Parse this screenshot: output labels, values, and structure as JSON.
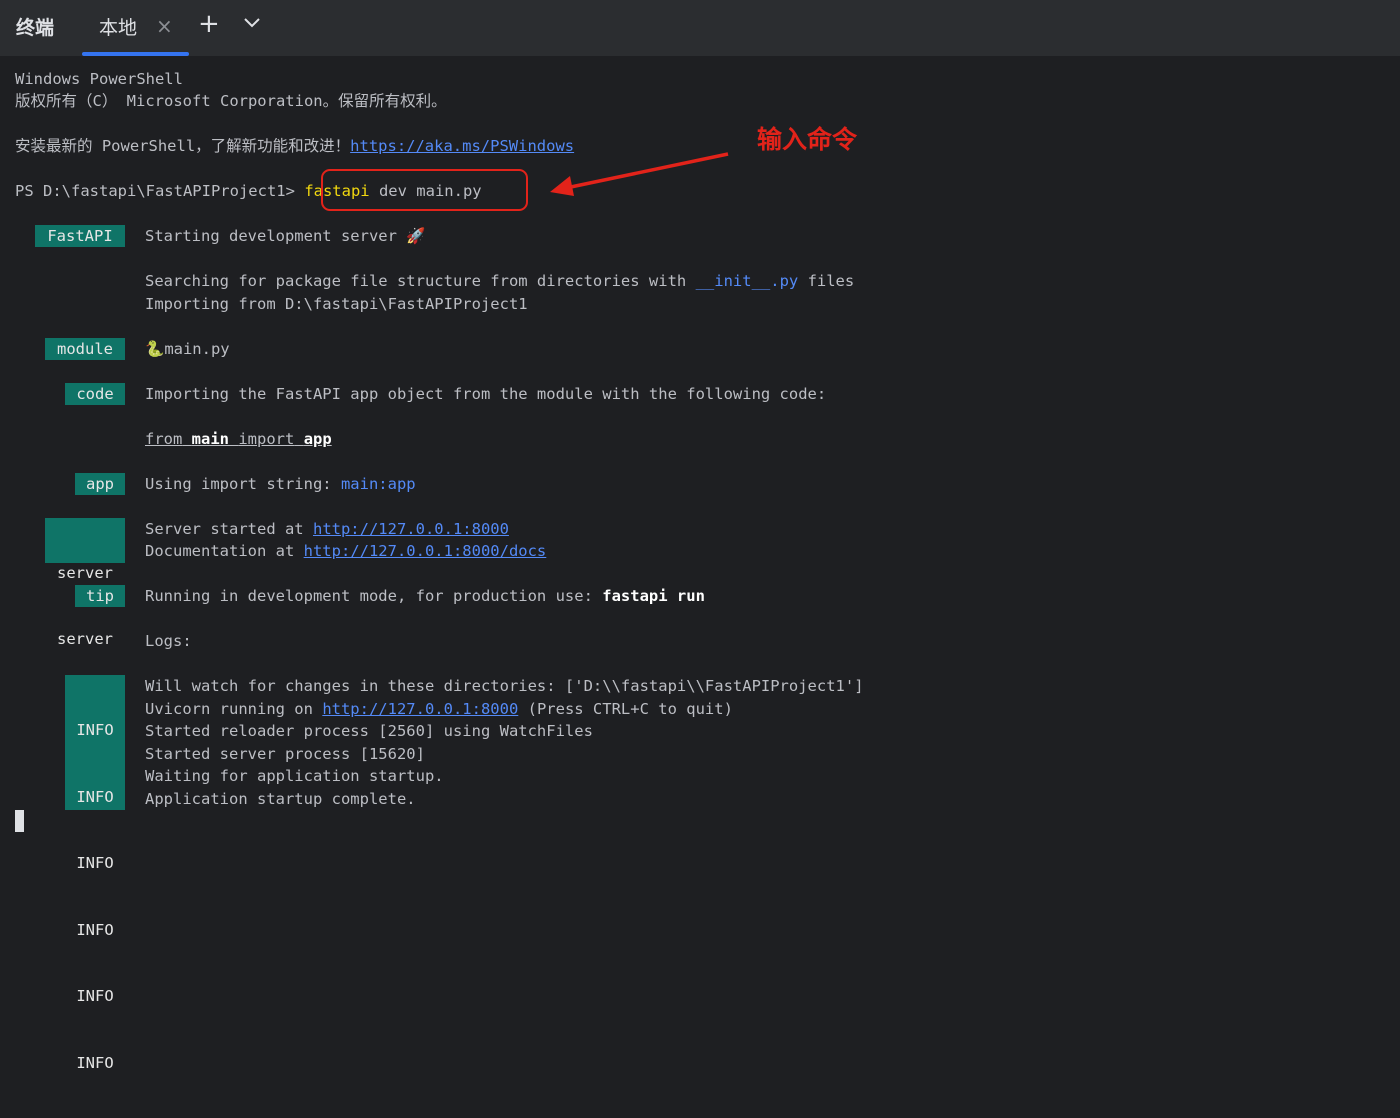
{
  "tool_window": {
    "title": "终端",
    "tab_label": "本地",
    "close_glyph": "×",
    "add_glyph": "+"
  },
  "terminal": {
    "header": [
      "Windows PowerShell",
      "版权所有（C） Microsoft Corporation。保留所有权利。"
    ],
    "install_prefix": "安装最新的 PowerShell，了解新功能和改进！",
    "install_link": "https://aka.ms/PSWindows",
    "prompt": "PS D:\\fastapi\\FastAPIProject1>",
    "command_exe": "fastapi",
    "command_args": " dev main.py",
    "blocks": {
      "fastapi": {
        "badge": "FastAPI",
        "line1": "Starting development server 🚀",
        "search_prefix": "Searching for package file structure from directories with ",
        "search_code": "__init__.py",
        "search_suffix": " files",
        "importing": "Importing from D:\\fastapi\\FastAPIProject1"
      },
      "module": {
        "badge": "module",
        "glyph": "🐍",
        "text": "main.py"
      },
      "code": {
        "badge": "code",
        "text": "Importing the FastAPI app object from the module with the following code:",
        "from_kw": "from",
        "module_name": "main",
        "import_kw": "import",
        "app_name": "app"
      },
      "app": {
        "badge": "app",
        "prefix": "Using import string: ",
        "import_string": "main:app"
      },
      "server": {
        "badge": "server",
        "started_prefix": "Server started at ",
        "started_url": "http://127.0.0.1:8000",
        "docs_prefix": "Documentation at ",
        "docs_url": "http://127.0.0.1:8000/docs"
      },
      "tip": {
        "badge": "tip",
        "prefix": "Running in development mode, for production use: ",
        "command": "fastapi run"
      },
      "logs_label": "Logs:",
      "info": {
        "badge": "INFO",
        "watch": "Will watch for changes in these directories: ['D:\\\\fastapi\\\\FastAPIProject1']",
        "uvicorn_prefix": "Uvicorn running on ",
        "uvicorn_url": "http://127.0.0.1:8000",
        "uvicorn_suffix": " (Press CTRL+C to quit)",
        "reloader": "Started reloader process [2560] using WatchFiles",
        "server_process": "Started server process [15620]",
        "waiting": "Waiting for application startup.",
        "complete": "Application startup complete."
      }
    }
  },
  "annotation": {
    "label": "输入命令",
    "color": "#e2231a"
  },
  "colors": {
    "background": "#1e1f22",
    "tabbar": "#2b2d30",
    "badge": "#0f7467",
    "link": "#548af7",
    "command": "#f2d80f",
    "tab_underline": "#3574f0"
  }
}
